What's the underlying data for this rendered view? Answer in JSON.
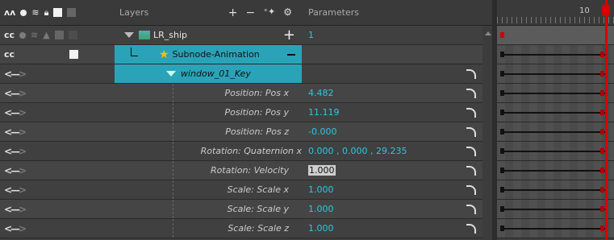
{
  "header": {
    "layers_label": "Layers",
    "parameters_label": "Parameters",
    "timeline_frame": "10",
    "tools": [
      "add-layer-icon",
      "remove-layer-icon",
      "add-peg-icon",
      "layer-properties-icon"
    ]
  },
  "colors": {
    "selected": "#2aa3b8",
    "value_text": "#2ec6df",
    "playhead": "#d80000"
  },
  "layers": {
    "ship": "LR_ship",
    "subnode": "Subnode-Animation",
    "key": "window_01_Key"
  },
  "ship_value": "1",
  "params": [
    {
      "name": "Position: Pos x",
      "value": "4.482"
    },
    {
      "name": "Position: Pos y",
      "value": "11.119"
    },
    {
      "name": "Position: Pos z",
      "value": "-0.000"
    },
    {
      "name": "Rotation: Quaternion x",
      "value": "0.000 , 0.000 , 29.235"
    },
    {
      "name": "Rotation: Velocity",
      "value": "1.000"
    },
    {
      "name": "Scale: Scale x",
      "value": "1.000"
    },
    {
      "name": "Scale: Scale y",
      "value": "1.000"
    },
    {
      "name": "Scale: Scale z",
      "value": "1.000"
    }
  ]
}
